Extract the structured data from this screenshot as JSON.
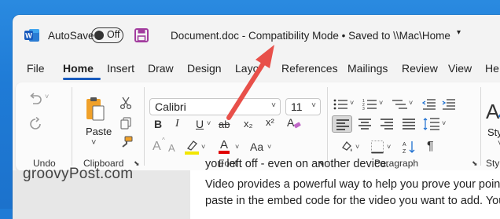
{
  "titlebar": {
    "app_icon": "word-icon",
    "autosave_label": "AutoSave",
    "autosave_state": "Off",
    "save_icon": "save-icon",
    "document_title": "Document.doc  -  Compatibility Mode • Saved to \\\\Mac\\Home",
    "title_caret": "▾"
  },
  "tabs": [
    {
      "label": "File"
    },
    {
      "label": "Home",
      "active": true
    },
    {
      "label": "Insert"
    },
    {
      "label": "Draw"
    },
    {
      "label": "Design"
    },
    {
      "label": "Layo"
    },
    {
      "label": "References"
    },
    {
      "label": "Mailings"
    },
    {
      "label": "Review"
    },
    {
      "label": "View"
    },
    {
      "label": "He"
    }
  ],
  "ribbon": {
    "undo_group": {
      "label": "Undo",
      "undo_icon": "undo-icon",
      "redo_icon": "redo-icon"
    },
    "clipboard_group": {
      "label": "Clipboard",
      "paste_label": "Paste",
      "paste_caret": "˅",
      "cut_icon": "scissors-icon",
      "copy_icon": "copy-icon",
      "format_painter_icon": "format-painter-icon"
    },
    "font_group": {
      "label": "Font",
      "font_name": "Calibri",
      "font_size": "11",
      "grow_font": "A",
      "shrink_font": "A",
      "bold": "B",
      "italic": "I",
      "underline": "U",
      "strikethrough": "ab",
      "subscript": "x₂",
      "superscript": "x²",
      "text_effects": "A",
      "font_color": "A",
      "change_case": "Aa"
    },
    "paragraph_group": {
      "label": "Paragraph",
      "pilcrow": "¶"
    },
    "styles_group": {
      "label": "Styles",
      "styles_label": "Styles"
    }
  },
  "document": {
    "line1": "you left off - even on another device.",
    "line2": "Video provides a powerful way to help you prove your point. W",
    "line3": "paste in the embed code for the video you want to add. You c"
  },
  "watermark": "groovyPost.com",
  "colors": {
    "accent": "#185abd",
    "arrow": "#e8504a",
    "highlight": "#f2e600",
    "font_color": "#e00000",
    "save_icon": "#a23c9e"
  }
}
